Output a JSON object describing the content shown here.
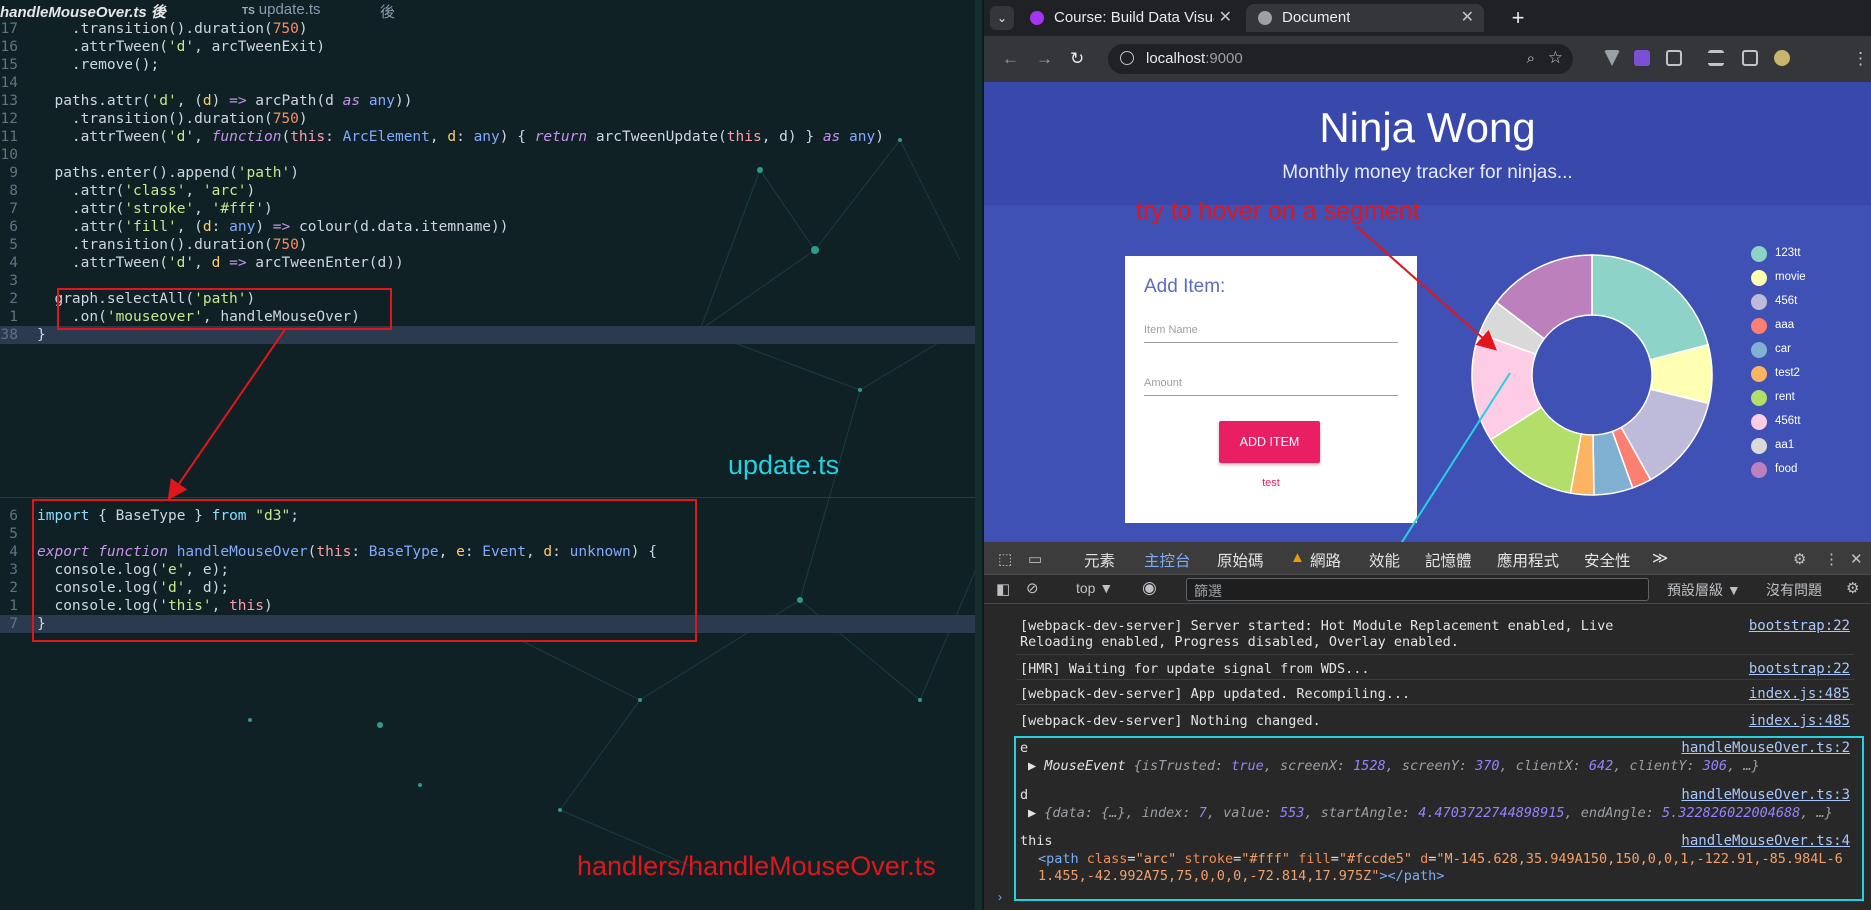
{
  "editor": {
    "tabs": [
      "handleMouseOver.ts 後",
      "update.ts",
      "後"
    ],
    "tab_ts_badge": "TS",
    "top_lines": [
      {
        "num": "17",
        "html": "    .transition().duration(<span class='n'>750</span>)"
      },
      {
        "num": "16",
        "html": "    .attrTween(<span class='s'>'d'</span>, arcTweenExit)"
      },
      {
        "num": "15",
        "html": "    .remove();"
      },
      {
        "num": "14",
        "html": ""
      },
      {
        "num": "13",
        "html": "  paths.attr(<span class='s'>'d'</span>, (<span class='t'>d</span>) <span class='k'>=&gt;</span> arcPath(d <span class='k'>as</span> <span class='ty'>any</span>))"
      },
      {
        "num": "12",
        "html": "    .transition().duration(<span class='n'>750</span>)"
      },
      {
        "num": "11",
        "html": "    .attrTween(<span class='s'>'d'</span>, <span class='k'>function</span>(<span class='pp'>this</span>: <span class='ty'>ArcElement</span>, <span class='t'>d</span>: <span class='ty'>any</span>) { <span class='k'>return</span> arcTweenUpdate(<span class='pp'>this</span>, d) } <span class='k'>as</span> <span class='ty'>any</span>)"
      },
      {
        "num": "10",
        "html": ""
      },
      {
        "num": "9",
        "html": "  paths.enter().append(<span class='s'>'path'</span>)"
      },
      {
        "num": "8",
        "html": "    .attr(<span class='s'>'class'</span>, <span class='s'>'arc'</span>)"
      },
      {
        "num": "7",
        "html": "    .attr(<span class='s'>'stroke'</span>, <span class='s'>'#fff'</span>)"
      },
      {
        "num": "6",
        "html": "    .attr(<span class='s'>'fill'</span>, (<span class='t'>d</span>: <span class='ty'>any</span>) <span class='k'>=&gt;</span> colour(d.data.itemname))"
      },
      {
        "num": "5",
        "html": "    .transition().duration(<span class='n'>750</span>)"
      },
      {
        "num": "4",
        "html": "    .attrTween(<span class='s'>'d'</span>, <span class='t'>d</span> <span class='k'>=&gt;</span> arcTweenEnter(d))"
      },
      {
        "num": "3",
        "html": ""
      },
      {
        "num": "2",
        "html": "  graph.selectAll(<span class='s'>'path'</span>)"
      },
      {
        "num": "1",
        "html": "    .on(<span class='s'>'mouseover'</span>, handleMouseOver)"
      },
      {
        "num": "38",
        "html": "}"
      }
    ],
    "bottom_lines": [
      {
        "num": "6",
        "html": "<span class='p'>import</span> { BaseType } <span class='p'>from</span> <span class='s'>\"d3\"</span>;"
      },
      {
        "num": "5",
        "html": ""
      },
      {
        "num": "4",
        "html": "<span class='k'>export</span> <span class='k'>function</span> <span class='f'>handleMouseOver</span>(<span class='pp'>this</span>: <span class='ty'>BaseType</span>, <span class='t'>e</span>: <span class='ty'>Event</span>, <span class='t'>d</span>: <span class='ty'>unknown</span>) {"
      },
      {
        "num": "3",
        "html": "  console.log(<span class='s'>'e'</span>, e);"
      },
      {
        "num": "2",
        "html": "  console.log(<span class='s'>'d'</span>, d);"
      },
      {
        "num": "1",
        "html": "  console.log(<span class='s'>'this'</span>, <span class='pp'>this</span>)"
      },
      {
        "num": "7",
        "html": "}"
      }
    ],
    "label_update": "update.ts",
    "label_handler": "handlers/handleMouseOver.ts"
  },
  "browser": {
    "tabs": [
      {
        "title": "Course: Build Data Visua",
        "close": "✕"
      },
      {
        "title": "Document",
        "close": "✕"
      }
    ],
    "new_tab": "+",
    "url_host": "localhost",
    "url_port": ":9000",
    "page": {
      "title": "Ninja Wong",
      "subtitle": "Monthly money tracker for ninjas...",
      "hint": "try to hover on a segment",
      "form": {
        "heading": "Add Item:",
        "item_name_label": "Item Name",
        "amount_label": "Amount",
        "button": "ADD ITEM",
        "error": "test"
      }
    },
    "chart_data": {
      "type": "pie",
      "categories": [
        "123tt",
        "movie",
        "456t",
        "aaa",
        "car",
        "test2",
        "rent",
        "456tt",
        "aa1",
        "food"
      ],
      "values": [
        20,
        7.5,
        12.5,
        2.5,
        5,
        3,
        12.5,
        14,
        4.5,
        14
      ],
      "colors": [
        "#8dd3c7",
        "#ffffb3",
        "#bebada",
        "#fb8072",
        "#80b1d3",
        "#fdb462",
        "#b3de69",
        "#fccde5",
        "#d9d9d9",
        "#bc80bd"
      ]
    }
  },
  "devtools": {
    "tabs": [
      "元素",
      "主控台",
      "原始碼",
      "網路",
      "效能",
      "記憶體",
      "應用程式",
      "安全性"
    ],
    "more": "≫",
    "context": "top ▼",
    "filter_placeholder": "篩選",
    "levels": "預設層級 ▼",
    "issues": "沒有問題",
    "logs": [
      {
        "text": "[webpack-dev-server] Server started: Hot Module Replacement enabled, Live Reloading enabled, Progress disabled, Overlay enabled.",
        "src": "bootstrap:22"
      },
      {
        "text": "[HMR] Waiting for update signal from WDS...",
        "src": "bootstrap:22"
      },
      {
        "text": "[webpack-dev-server] App updated. Recompiling...",
        "src": "index.js:485"
      },
      {
        "text": "[webpack-dev-server] Nothing changed.",
        "src": "index.js:485"
      }
    ],
    "log_e": {
      "label": "e",
      "src": "handleMouseOver.ts:2"
    },
    "log_d": {
      "label": "d",
      "src": "handleMouseOver.ts:3"
    },
    "log_this": {
      "label": "this",
      "src": "handleMouseOver.ts:4"
    },
    "e_obj": "▶ <span class='ob-k'>MouseEvent</span> <span class='ob-s'>{isTrusted: </span><span class='ob-b'>true</span><span class='ob-s'>, screenX: </span><span class='ob-b'>1528</span><span class='ob-s'>, screenY: </span><span class='ob-b'>370</span><span class='ob-s'>, clientX: </span><span class='ob-b'>642</span><span class='ob-s'>, clientY: </span><span class='ob-b'>306</span><span class='ob-s'>, …}</span>",
    "d_obj": "▶ <span class='ob-s'>{data: {…}, index: </span><span class='ob-b'>7</span><span class='ob-s'>, value: </span><span class='ob-b'>553</span><span class='ob-s'>, startAngle: </span><span class='ob-b'>4.4703722744898915</span><span class='ob-s'>, endAngle: </span><span class='ob-b'>5.322826022004688</span><span class='ob-s'>, …}</span>",
    "this_el": "<span class='el-t'>&lt;path</span> <span class='el-a'>class</span>=<span class='el-v'>\"arc\"</span> <span class='el-a'>stroke</span>=<span class='el-v'>\"#fff\"</span> <span class='el-a'>fill</span>=<span class='el-v'>\"#fccde5\"</span> <span class='el-a'>d</span>=<span class='el-v'>\"M-145.628,35.949A150,150,0,0,1,-122.91,-85.984L-61.455,-42.992A75,75,0,0,0,-72.814,17.975Z\"</span><span class='el-t'>&gt;&lt;/path&gt;</span>"
  }
}
